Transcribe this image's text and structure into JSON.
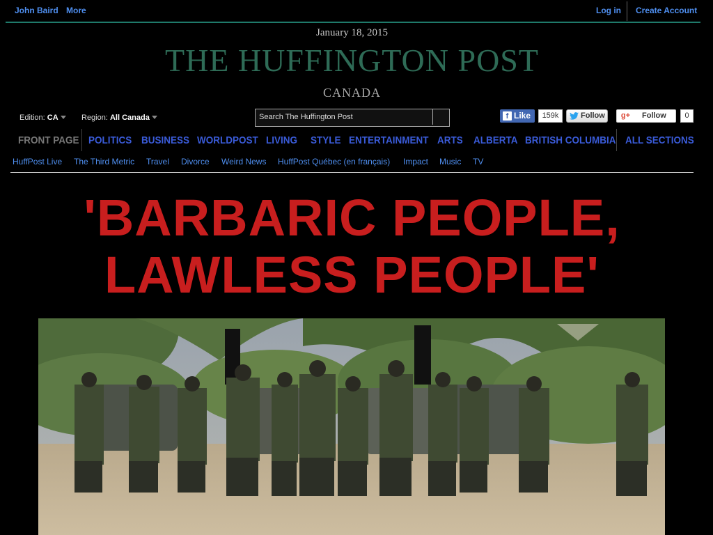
{
  "topbar": {
    "user_name": "John Baird",
    "more_label": "More",
    "login_label": "Log in",
    "create_account_label": "Create Account"
  },
  "masthead": {
    "date": "January 18, 2015",
    "logo_text": "THE HUFFINGTON POST",
    "edition_name": "CANADA"
  },
  "controls": {
    "edition_label": "Edition:",
    "edition_value": "CA",
    "region_label": "Region:",
    "region_value": "All Canada",
    "search_placeholder": "Search The Huffington Post"
  },
  "social": {
    "fb_like_label": "Like",
    "fb_count": "159k",
    "twitter_label": "Follow",
    "gplus_label": "Follow",
    "gplus_count": "0"
  },
  "main_nav": [
    "FRONT PAGE",
    "POLITICS",
    "BUSINESS",
    "WORLDPOST",
    "LIVING",
    "STYLE",
    "ENTERTAINMENT",
    "ARTS",
    "ALBERTA",
    "BRITISH COLUMBIA",
    "ALL SECTIONS"
  ],
  "sub_nav": [
    "HuffPost Live",
    "The Third Metric",
    "Travel",
    "Divorce",
    "Weird News",
    "HuffPost Québec (en français)",
    "Impact",
    "Music",
    "TV"
  ],
  "headline": {
    "line1": "'BARBARIC PEOPLE,",
    "line2": "LAWLESS PEOPLE'"
  },
  "colors": {
    "background": "#000000",
    "link_blue": "#4f8ff0",
    "nav_blue": "#3a5bd9",
    "logo_green": "#2e6b56",
    "headline_red": "#c81e1e",
    "topbar_rule": "#1f7a6a"
  }
}
